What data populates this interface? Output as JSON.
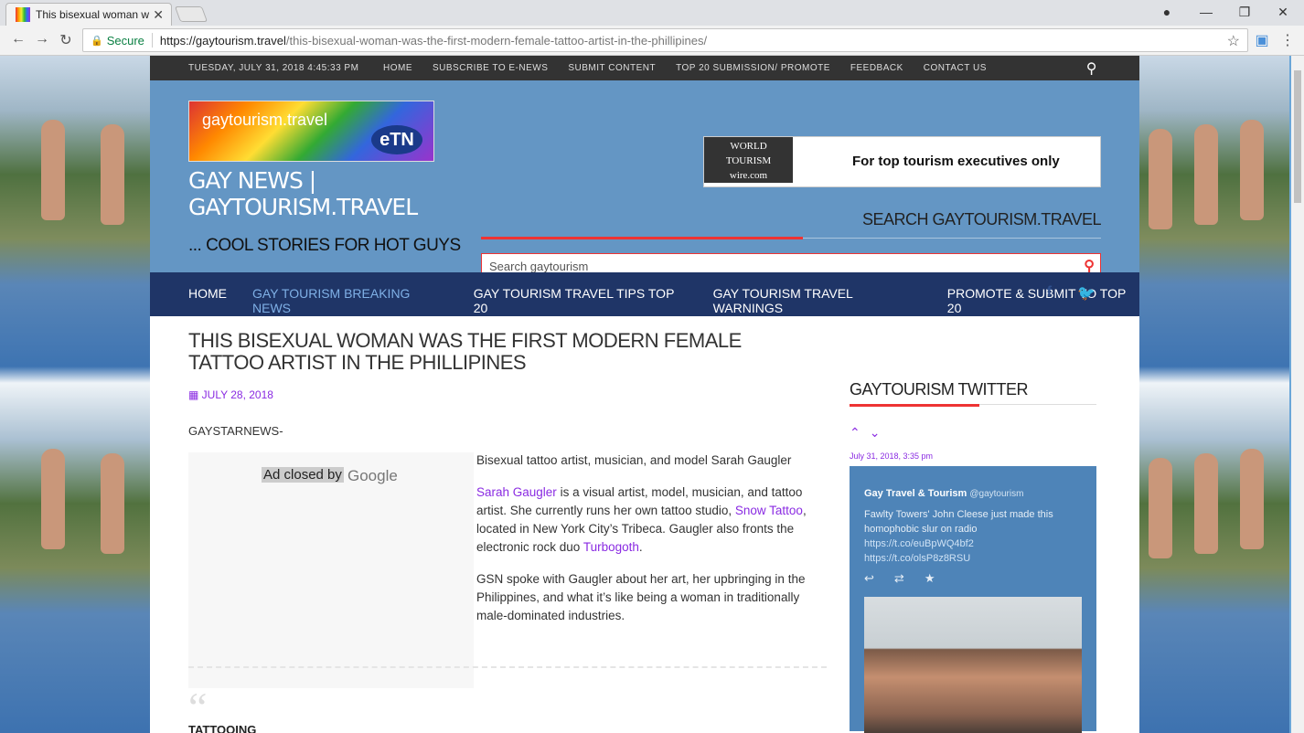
{
  "browser": {
    "tab_title": "This bisexual woman was",
    "secure_label": "Secure",
    "url_host": "https://gaytourism.travel",
    "url_path": "/this-bisexual-woman-was-the-first-modern-female-tattoo-artist-in-the-phillipines/"
  },
  "topbar": {
    "date": "TUESDAY, JULY 31, 2018   4:45:33 PM",
    "links": [
      "HOME",
      "SUBSCRIBE TO E-NEWS",
      "SUBMIT CONTENT",
      "TOP 20 SUBMISSION/ PROMOTE",
      "FEEDBACK",
      "CONTACT US"
    ]
  },
  "header": {
    "logo_text": "gaytourism.travel",
    "logo_badge": "eTN",
    "site_title": "GAY NEWS | GAYTOURISM.TRAVEL",
    "tagline": "... COOL STORIES FOR HOT GUYS",
    "ad_logo_lines": [
      "WORLD",
      "TOURISM",
      "wire.com"
    ],
    "ad_text": "For top  tourism executives only",
    "search_label": "SEARCH GAYTOURISM.TRAVEL",
    "search_placeholder": "Search gaytourism"
  },
  "nav": {
    "items": [
      "HOME",
      "GAY TOURISM BREAKING NEWS",
      "GAY TOURISM TRAVEL TIPS TOP 20",
      "GAY TOURISM TRAVEL WARNINGS",
      "PROMOTE & SUBMIT TO TOP 20"
    ]
  },
  "post": {
    "title": "THIS BISEXUAL WOMAN WAS THE FIRST MODERN FEMALE TATTOO ARTIST IN THE PHILLIPINES",
    "date": "JULY 28, 2018",
    "source": "GAYSTARNEWS-",
    "ad_closed": "Ad closed by",
    "ad_google": "Google",
    "intro": "Bisexual tattoo artist, musician, and model Sarah Gaugler",
    "p1_link1": "Sarah Gaugler",
    "p1_text1": " is a visual artist, model, musician, and tattoo artist. She currently runs her own tattoo studio, ",
    "p1_link2": "Snow Tattoo",
    "p1_text2": ", located in New York City’s Tribeca. Gaugler also fronts the electronic rock duo ",
    "p1_link3": "Turbogoth",
    "p1_text3": ".",
    "p2": "GSN spoke with Gaugler about her art, her upbringing in the Philippines, and what it’s like being a woman in traditionally male-dominated industries.",
    "subhead": "TATTOOING"
  },
  "sidebar": {
    "heading": "GAYTOURISM TWITTER",
    "tweet_date": "July 31, 2018, 3:35 pm",
    "tweet_user": "Gay Travel & Tourism",
    "tweet_handle": "@gaytourism",
    "tweet_text": "Fawlty Towers' John Cleese just made this homophobic slur on radio",
    "tweet_link1": "https://t.co/euBpWQ4bf2",
    "tweet_link2": "https://t.co/olsP8z8RSU"
  }
}
